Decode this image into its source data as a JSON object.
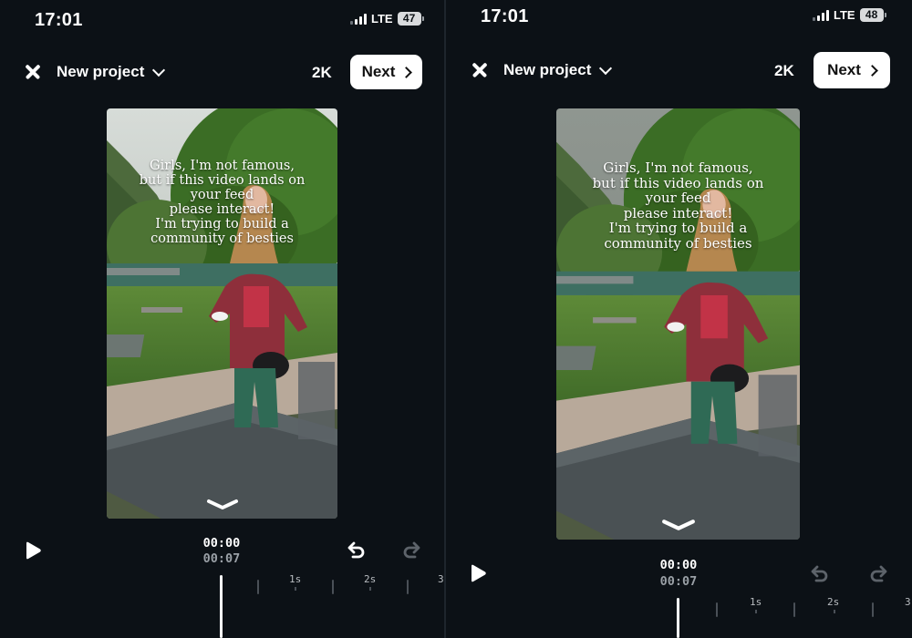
{
  "panels": [
    {
      "status": {
        "time": "17:01",
        "network": "LTE",
        "battery": "47"
      },
      "header": {
        "project_title": "New project",
        "resolution": "2K",
        "next_label": "Next"
      },
      "video": {
        "overlay_lines": [
          "Girls, I'm not famous,",
          "but if this video lands on",
          "your feed",
          "please interact!",
          "I'm trying to build a",
          "community of besties"
        ]
      },
      "timeline": {
        "current_time": "00:00",
        "total_time": "00:07",
        "ruler_labels": [
          "1s",
          "2s",
          "3"
        ]
      }
    },
    {
      "status": {
        "time": "17:01",
        "network": "LTE",
        "battery": "48"
      },
      "header": {
        "project_title": "New project",
        "resolution": "2K",
        "next_label": "Next"
      },
      "video": {
        "overlay_lines": [
          "Girls, I'm not famous,",
          "but if this video lands on",
          "your feed",
          "please interact!",
          "I'm trying to build a",
          "community of besties"
        ]
      },
      "timeline": {
        "current_time": "00:00",
        "total_time": "00:07",
        "ruler_labels": [
          "1s",
          "2s",
          "3"
        ]
      }
    }
  ]
}
